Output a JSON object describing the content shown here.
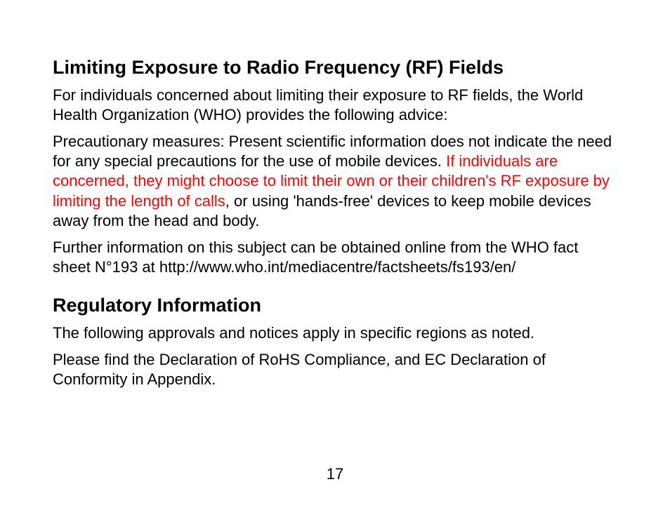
{
  "section1": {
    "title": "Limiting Exposure to Radio Frequency (RF) Fields",
    "p1": "For individuals concerned about limiting their exposure to RF fields, the World Health Organization (WHO) provides the following advice:",
    "p2_a": "Precautionary measures: Present scientific information does not indicate the need for any special precautions for the use of mobile devices. ",
    "p2_highlight": "If individuals are concerned, they might choose to limit their own or their children's RF exposure by limiting the length of calls",
    "p2_c": ", or using 'hands-free' devices to keep mobile devices away from the head and body.",
    "p3": "Further information on this subject can be obtained online from the WHO fact sheet N°193 at http://www.who.int/mediacentre/factsheets/fs193/en/"
  },
  "section2": {
    "title": "Regulatory Information",
    "p1": "The following approvals and notices apply in specific regions as noted.",
    "p2": "Please find the Declaration of RoHS Compliance, and EC Declaration of Conformity in Appendix."
  },
  "page_number": "17"
}
